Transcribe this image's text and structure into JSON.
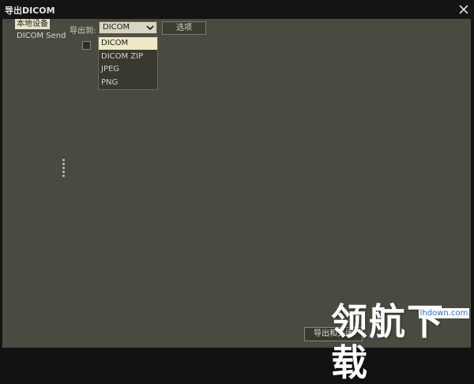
{
  "window": {
    "title": "导出DICOM",
    "close_icon": "close-icon"
  },
  "sidebar": {
    "items": [
      {
        "label": "本地设备",
        "selected": true
      },
      {
        "label": "DICOM Send",
        "selected": false
      }
    ]
  },
  "export": {
    "label": "导出到:",
    "format_select": {
      "value": "DICOM",
      "options": [
        "DICOM",
        "DICOM ZIP",
        "JPEG",
        "PNG"
      ]
    },
    "options_button": "选项",
    "checkbox_checked": false
  },
  "footer": {
    "export_close_button": "导出和关闭"
  },
  "watermark": {
    "text": "领航下载",
    "url": "lhdown.com"
  },
  "colors": {
    "panel_bg": "#4b4a40",
    "title_bg": "#141414",
    "selected_item_bg": "#e8e4c8",
    "dropdown_highlight": "#efe8c5",
    "watermark_url_color": "#2a6fc9"
  }
}
